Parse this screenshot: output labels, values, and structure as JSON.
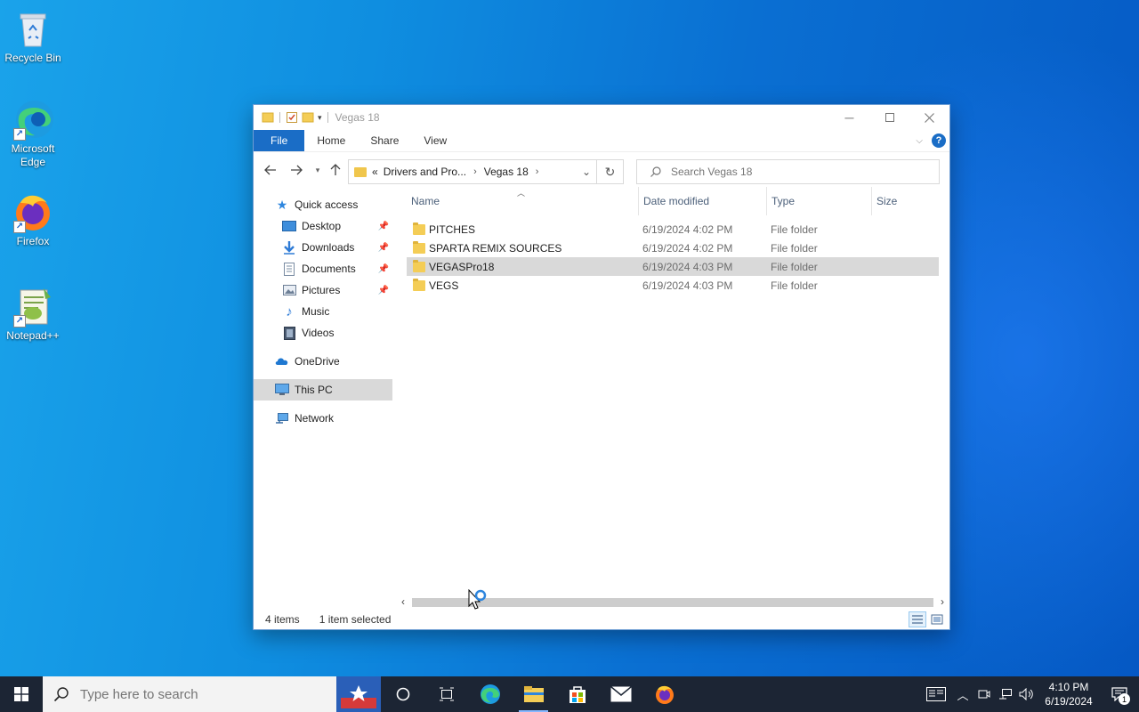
{
  "desktop": {
    "icons": [
      {
        "label": "Recycle Bin",
        "icon": "recycle-bin-icon"
      },
      {
        "label": "Microsoft Edge",
        "icon": "edge-icon"
      },
      {
        "label": "Firefox",
        "icon": "firefox-icon"
      },
      {
        "label": "Notepad++",
        "icon": "notepadpp-icon"
      }
    ]
  },
  "window": {
    "title": "Vegas 18",
    "tabs": {
      "file": "File",
      "home": "Home",
      "share": "Share",
      "view": "View"
    },
    "help": "?",
    "address": {
      "overflow": "«",
      "crumb1": "Drivers and Pro...",
      "crumb2": "Vegas 18"
    },
    "search": {
      "placeholder": "Search Vegas 18"
    },
    "navpane": {
      "quick_access": "Quick access",
      "desktop": "Desktop",
      "downloads": "Downloads",
      "documents": "Documents",
      "pictures": "Pictures",
      "music": "Music",
      "videos": "Videos",
      "onedrive": "OneDrive",
      "this_pc": "This PC",
      "network": "Network"
    },
    "columns": {
      "name": "Name",
      "date": "Date modified",
      "type": "Type",
      "size": "Size"
    },
    "files": [
      {
        "name": "PITCHES",
        "date": "6/19/2024 4:02 PM",
        "type": "File folder",
        "selected": false
      },
      {
        "name": "SPARTA REMIX SOURCES",
        "date": "6/19/2024 4:02 PM",
        "type": "File folder",
        "selected": false
      },
      {
        "name": "VEGASPro18",
        "date": "6/19/2024 4:03 PM",
        "type": "File folder",
        "selected": true
      },
      {
        "name": "VEGS",
        "date": "6/19/2024 4:03 PM",
        "type": "File folder",
        "selected": false
      }
    ],
    "status": {
      "items": "4 items",
      "selected": "1 item selected"
    }
  },
  "taskbar": {
    "search_placeholder": "Type here to search",
    "time": "4:10 PM",
    "date": "6/19/2024",
    "notification_count": "1"
  },
  "colors": {
    "accent": "#1a6dc6",
    "folder": "#f4cd56",
    "taskbar": "#1c2534"
  }
}
